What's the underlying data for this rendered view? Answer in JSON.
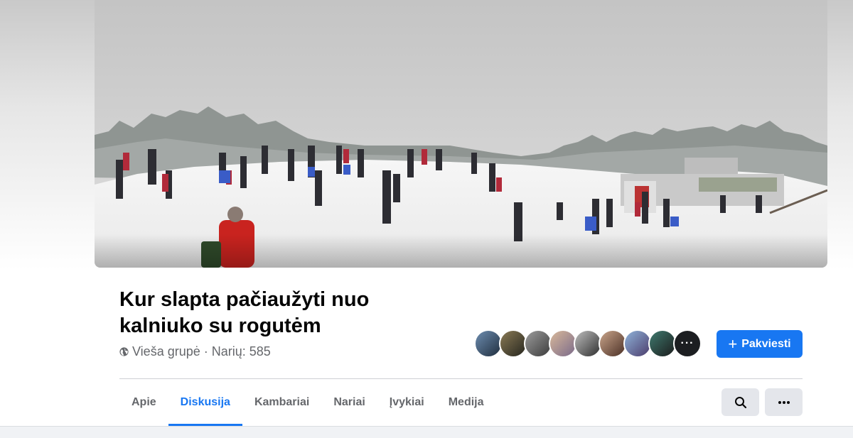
{
  "group": {
    "name": "Kur slapta pačiaužyti nuo kalniuko su rogutėm",
    "privacy": "Vieša grupė",
    "members_text": "· Narių: 585"
  },
  "actions": {
    "invite_label": "Pakviesti",
    "more_glyph": "···"
  },
  "tabs": [
    {
      "label": "Apie",
      "active": false
    },
    {
      "label": "Diskusija",
      "active": true
    },
    {
      "label": "Kambariai",
      "active": false
    },
    {
      "label": "Nariai",
      "active": false
    },
    {
      "label": "Įvykiai",
      "active": false
    },
    {
      "label": "Medija",
      "active": false
    }
  ],
  "colors": {
    "accent": "#1877f2",
    "text_primary": "#050505",
    "text_secondary": "#65676b",
    "button_secondary": "#e4e6eb"
  },
  "icons": {
    "privacy": "globe-icon",
    "invite": "plus-icon",
    "search": "search-icon",
    "more": "more-icon"
  }
}
